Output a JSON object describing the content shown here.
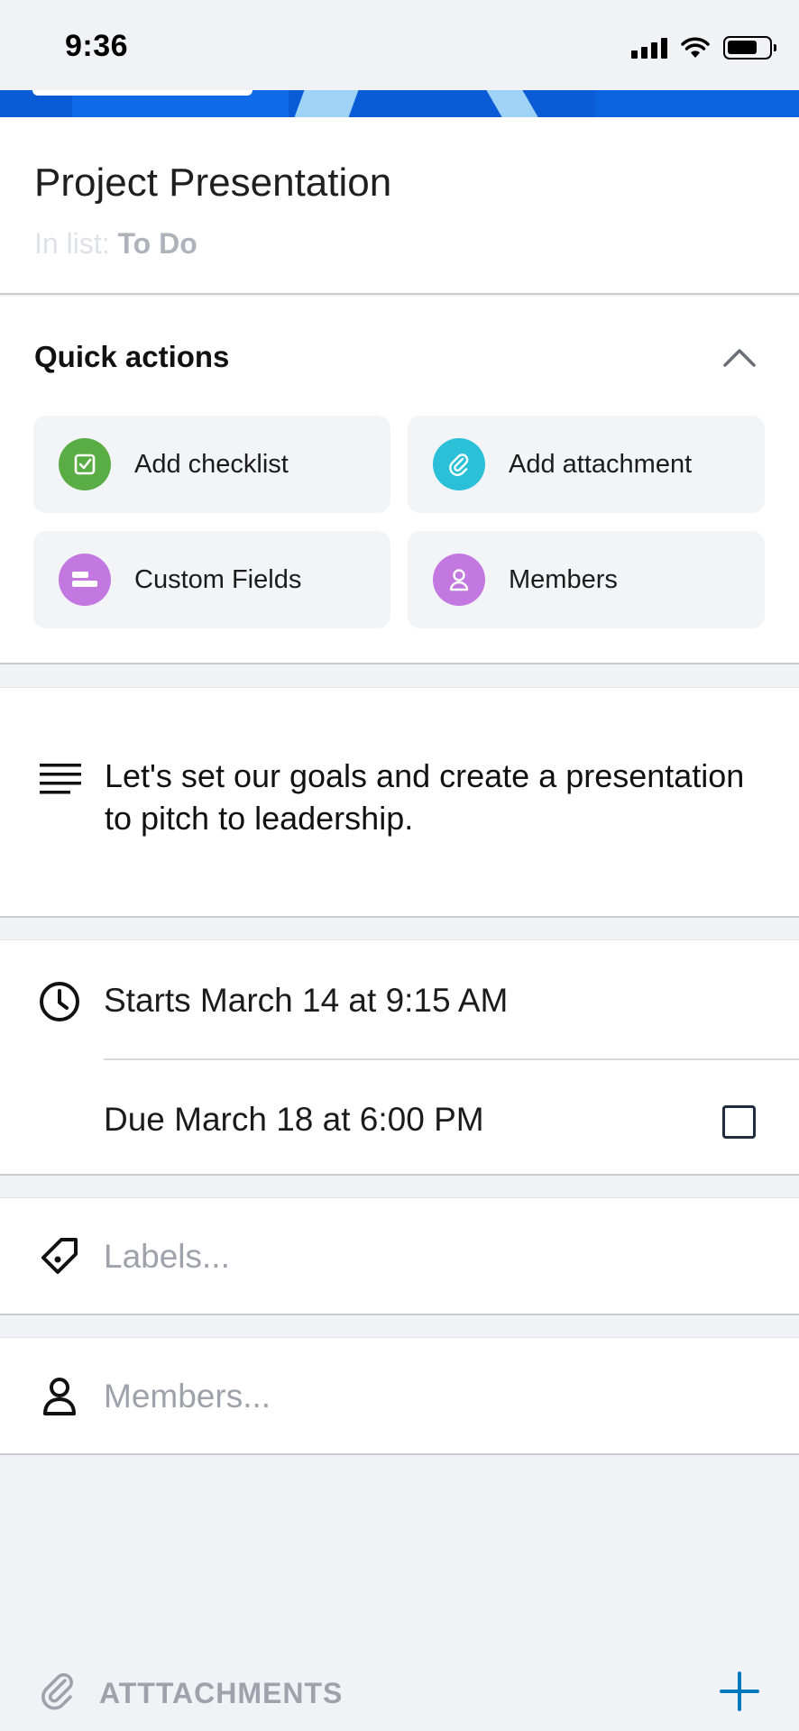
{
  "status_bar": {
    "time": "9:36"
  },
  "card": {
    "title": "Project Presentation",
    "in_list_prefix": "In list: ",
    "list_name": "To Do"
  },
  "quick_actions": {
    "title": "Quick actions",
    "buttons": [
      {
        "label": "Add checklist",
        "icon": "checklist-icon",
        "color": "#5aac44"
      },
      {
        "label": "Add attachment",
        "icon": "paperclip-icon",
        "color": "#29c0d8"
      },
      {
        "label": "Custom Fields",
        "icon": "custom-fields-icon",
        "color": "#c377e0"
      },
      {
        "label": "Members",
        "icon": "person-icon",
        "color": "#c377e0"
      }
    ]
  },
  "description": {
    "text": "Let's set our goals and create a presentation to pitch to leadership."
  },
  "dates": {
    "start": "Starts March 14 at 9:15 AM",
    "due": "Due March 18 at 6:00 PM",
    "due_complete": false
  },
  "labels": {
    "placeholder": "Labels..."
  },
  "members": {
    "placeholder": "Members..."
  },
  "attachments": {
    "label": "ATTTACHMENTS"
  },
  "colors": {
    "accent": "#0a5bd6",
    "add_button": "#0079bf"
  }
}
